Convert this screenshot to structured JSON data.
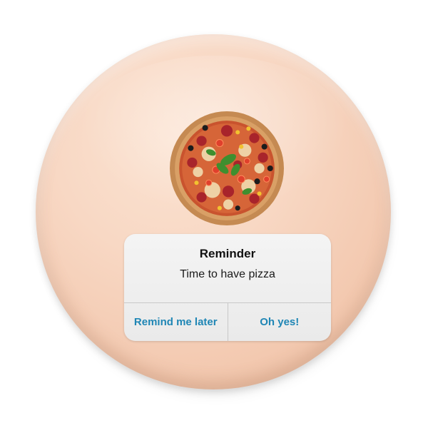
{
  "alert": {
    "title": "Reminder",
    "message": "Time to have pizza",
    "buttons": {
      "secondary": "Remind me later",
      "primary": "Oh yes!"
    }
  },
  "colors": {
    "pin_background": "#f8d8c4",
    "alert_background": "#eeeeee",
    "button_text": "#1f86b5",
    "title_text": "#111111"
  },
  "icons": {
    "pizza_illustration": "pizza-icon"
  }
}
